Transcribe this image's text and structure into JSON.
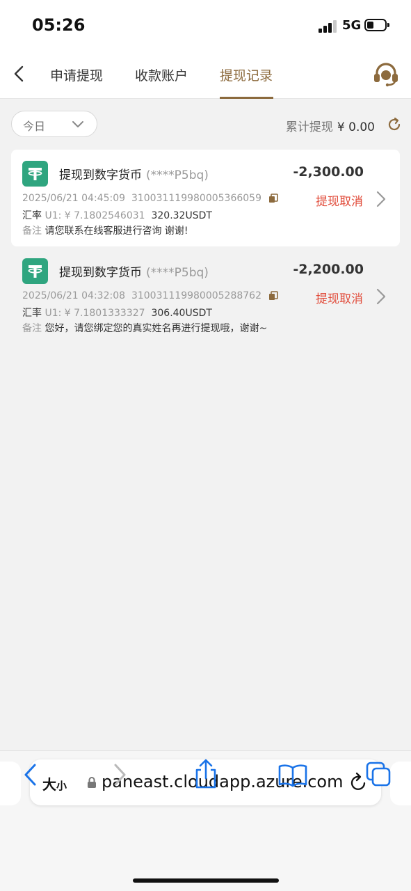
{
  "status": {
    "time": "05:26",
    "network": "5G"
  },
  "nav": {
    "tabs": [
      {
        "label": "申请提现"
      },
      {
        "label": "收款账户"
      },
      {
        "label": "提现记录"
      }
    ]
  },
  "filter": {
    "date_label": "今日",
    "total_label": "累计提现",
    "total_value": "¥ 0.00"
  },
  "records": [
    {
      "title": "提现到数字货币",
      "account": "(****P5bq)",
      "amount": "-2,300.00",
      "datetime": "2025/06/21 04:45:09",
      "order_no": "310031119980005366059",
      "rate_label": "汇率",
      "rate_value": "U1: ¥ 7.1802546031",
      "usdt": "320.32USDT",
      "note_label": "备注",
      "note": "请您联系在线客服进行咨询 谢谢!",
      "status": "提现取消"
    },
    {
      "title": "提现到数字货币",
      "account": "(****P5bq)",
      "amount": "-2,200.00",
      "datetime": "2025/06/21 04:32:08",
      "order_no": "310031119980005288762",
      "rate_label": "汇率",
      "rate_value": "U1: ¥ 7.1801333327",
      "usdt": "306.40USDT",
      "note_label": "备注",
      "note": "您好，请您绑定您的真实姓名再进行提现哦，谢谢~",
      "status": "提现取消"
    }
  ],
  "browser": {
    "aa_big": "大",
    "aa_small": "小",
    "url": "paneast.cloudapp.azure.com"
  },
  "colors": {
    "accent": "#8c6a3d",
    "cancel": "#e14b3a",
    "coin": "#2fa57f"
  }
}
